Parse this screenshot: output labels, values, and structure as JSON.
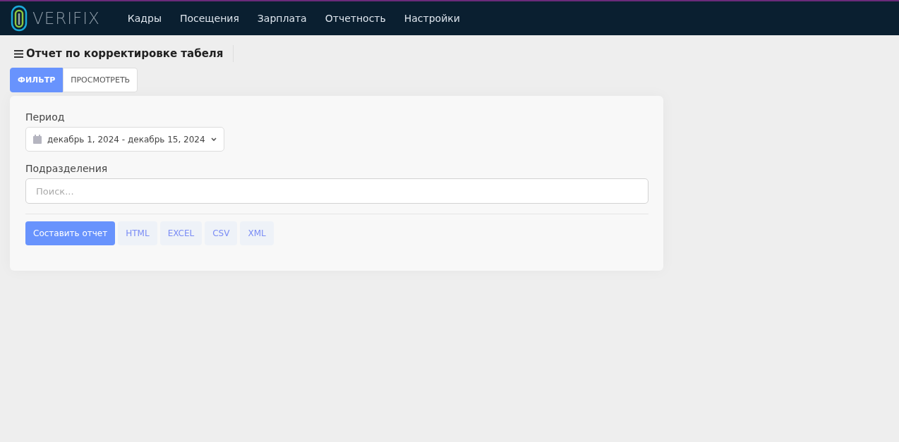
{
  "brand": "VERIFIX",
  "nav": [
    {
      "label": "Кадры"
    },
    {
      "label": "Посещения"
    },
    {
      "label": "Зарплата"
    },
    {
      "label": "Отчетность"
    },
    {
      "label": "Настройки"
    }
  ],
  "page_title": "Отчет по корректировке табеля",
  "tabs": [
    {
      "label": "ФИЛЬТР",
      "selected": true
    },
    {
      "label": "ПРОСМОТРЕТЬ",
      "selected": false
    }
  ],
  "period": {
    "label": "Период",
    "value": "декабрь 1, 2024 - декабрь 15, 2024"
  },
  "divisions": {
    "label": "Подразделения",
    "placeholder": "Поиск..."
  },
  "buttons": [
    {
      "label": "Составить отчет",
      "kind": "primary"
    },
    {
      "label": "HTML",
      "kind": "export"
    },
    {
      "label": "EXCEL",
      "kind": "export"
    },
    {
      "label": "CSV",
      "kind": "export"
    },
    {
      "label": "XML",
      "kind": "export"
    }
  ]
}
